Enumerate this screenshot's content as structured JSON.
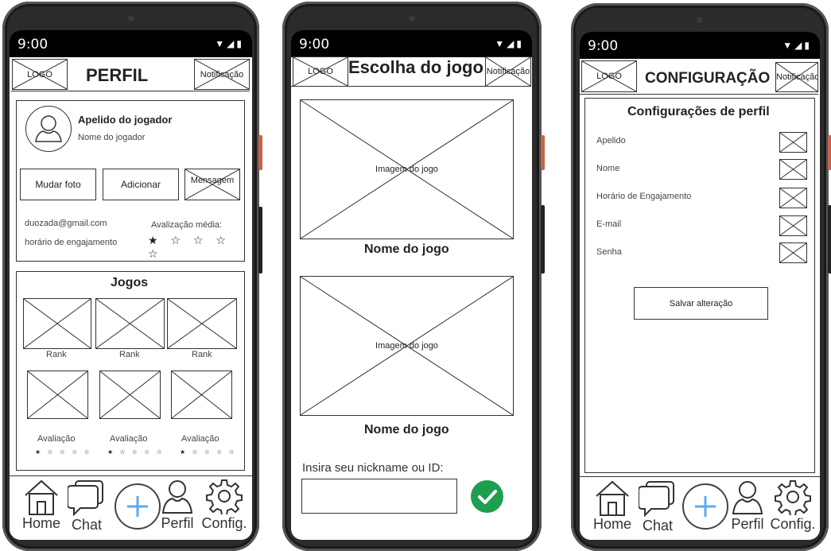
{
  "status": {
    "time": "9:00"
  },
  "profile": {
    "header": {
      "logo": "LOGO",
      "title": "PERFIL",
      "notification": "Notificação"
    },
    "nickname": "Apelido do jogador",
    "player_name": "Nome do jogador",
    "buttons": {
      "change_photo": "Mudar foto",
      "add": "Adicionar",
      "message": "Mensagem"
    },
    "email": "duozada@gmail.com",
    "engagement": "horário de engajamento",
    "rating_label": "Avalização média:",
    "rating_stars": "★ ☆ ☆ ☆ ☆",
    "games_title": "Jogos",
    "rank_labels": [
      "Rank",
      "Rank",
      "Rank"
    ],
    "eval_labels": [
      "Avaliação",
      "Avaliação",
      "Avaliação"
    ],
    "mini_stars": "★ ☆ ☆ ☆ ☆"
  },
  "game_choice": {
    "header": {
      "logo": "LOGO",
      "title": "Escolha do jogo",
      "notification": "Notificação"
    },
    "games": [
      {
        "image_label": "Imagem do jogo",
        "name": "Nome do jogo"
      },
      {
        "image_label": "Imagem do jogo",
        "name": "Nome do jogo"
      }
    ],
    "nickname_prompt": "Insira seu nickname ou ID:",
    "nickname_value": ""
  },
  "settings": {
    "header": {
      "logo": "LOGO",
      "title": "CONFIGURAÇÃO",
      "notification": "Notificação"
    },
    "section_title": "Configurações de perfil",
    "fields": [
      "Apelido",
      "Nome",
      "Horário de Engajamento",
      "E-mail",
      "Senha"
    ],
    "save_button": "Salvar alteração"
  },
  "nav": {
    "home": "Home",
    "chat": "Chat",
    "profile": "Perfil",
    "config": "Config."
  },
  "colors": {
    "accent": "#5aabf0",
    "confirm": "#1f9e4f",
    "frame": "#2b2b2b",
    "power_button": "#c8624a"
  }
}
